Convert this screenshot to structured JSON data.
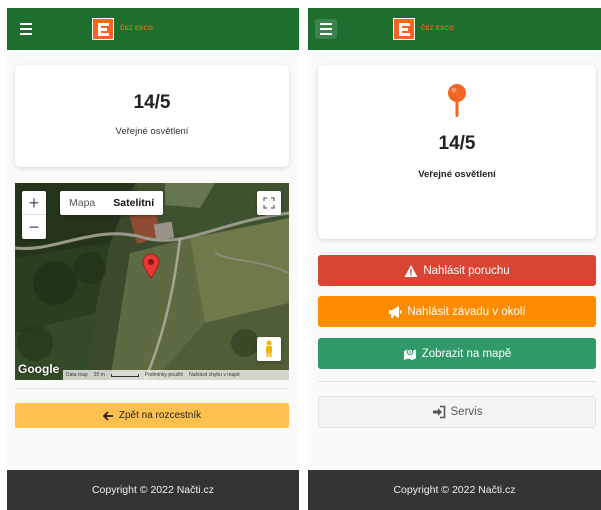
{
  "brand": {
    "name": "ČEZ ESCO",
    "accent": "#f26522",
    "navbar_color": "#1e6e2e"
  },
  "location": {
    "code": "14/5",
    "type": "Veřejné osvětlení"
  },
  "map": {
    "type_options": [
      "Mapa",
      "Satelitní"
    ],
    "selected_type": "Satelitní",
    "zoom_in": "+",
    "zoom_out": "−",
    "provider": "Google",
    "footer": {
      "data": "Data map",
      "scale": "20 m",
      "terms": "Podmínky použití",
      "report": "Nahlásit chybu v mapě"
    }
  },
  "left_panel": {
    "back_label": "Zpět na rozcestník"
  },
  "right_panel": {
    "actions": [
      {
        "label": "Nahlásit poruchu",
        "icon": "warning-icon",
        "color": "#da4433"
      },
      {
        "label": "Nahlásit závadu v okolí",
        "icon": "megaphone-icon",
        "color": "#ff8c00"
      },
      {
        "label": "Zobrazit na mapě",
        "icon": "map-icon",
        "color": "#2f9a68"
      }
    ],
    "servis_label": "Servis"
  },
  "footer": {
    "copyright": "Copyright © 2022 Načti.cz"
  }
}
